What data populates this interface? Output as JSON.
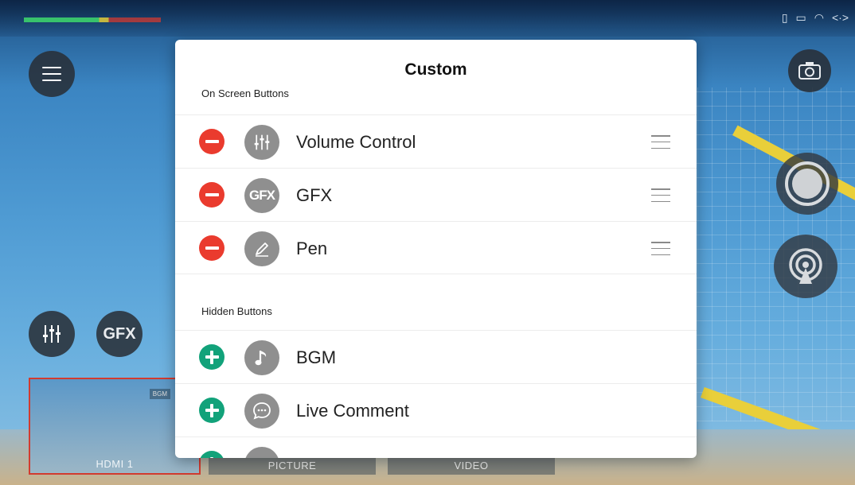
{
  "modal": {
    "title": "Custom",
    "on_screen_label": "On Screen Buttons",
    "hidden_label": "Hidden Buttons",
    "on_screen_buttons": [
      {
        "label": "Volume Control",
        "icon": "volume-control-icon"
      },
      {
        "label": "GFX",
        "icon": "gfx-icon"
      },
      {
        "label": "Pen",
        "icon": "pen-icon"
      }
    ],
    "hidden_buttons": [
      {
        "label": "BGM",
        "icon": "music-note-icon"
      },
      {
        "label": "Live Comment",
        "icon": "chat-bubble-icon"
      }
    ],
    "colors": {
      "remove": "#ea3b2e",
      "add": "#12a27a",
      "icon_bg": "#8f8f8f"
    }
  },
  "overlay": {
    "gfx_button_text": "GFX",
    "sources": [
      {
        "label": "HDMI 1",
        "badge": "BGM",
        "active": true
      },
      {
        "label": "PICTURE"
      },
      {
        "label": "VIDEO"
      }
    ],
    "colors": {
      "active_border": "#d23b2f",
      "record_button": "#cfd2d5"
    }
  }
}
